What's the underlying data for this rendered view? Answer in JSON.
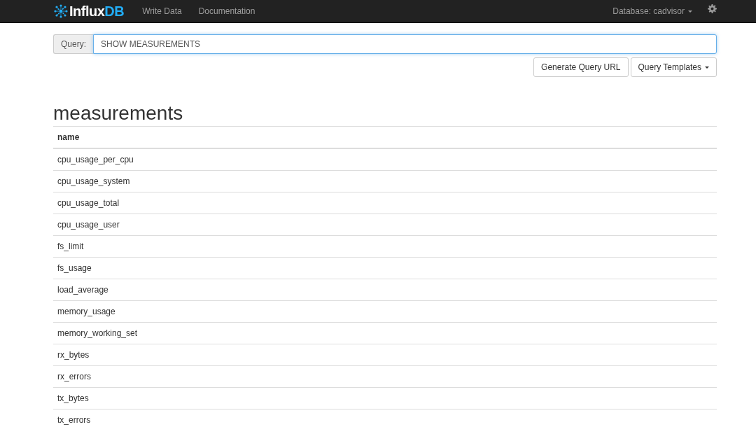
{
  "navbar": {
    "brand": {
      "name": "Influx",
      "suffix": "DB"
    },
    "links": [
      "Write Data",
      "Documentation"
    ],
    "database": "Database: cadvisor"
  },
  "query": {
    "label": "Query:",
    "value": "SHOW MEASUREMENTS",
    "buttons": [
      {
        "label": "Generate Query URL",
        "dropdown": false
      },
      {
        "label": "Query Templates",
        "dropdown": true
      }
    ]
  },
  "result": {
    "title": "measurements",
    "columns": [
      "name"
    ],
    "rows": [
      [
        "cpu_usage_per_cpu"
      ],
      [
        "cpu_usage_system"
      ],
      [
        "cpu_usage_total"
      ],
      [
        "cpu_usage_user"
      ],
      [
        "fs_limit"
      ],
      [
        "fs_usage"
      ],
      [
        "load_average"
      ],
      [
        "memory_usage"
      ],
      [
        "memory_working_set"
      ],
      [
        "rx_bytes"
      ],
      [
        "rx_errors"
      ],
      [
        "tx_bytes"
      ],
      [
        "tx_errors"
      ]
    ]
  }
}
